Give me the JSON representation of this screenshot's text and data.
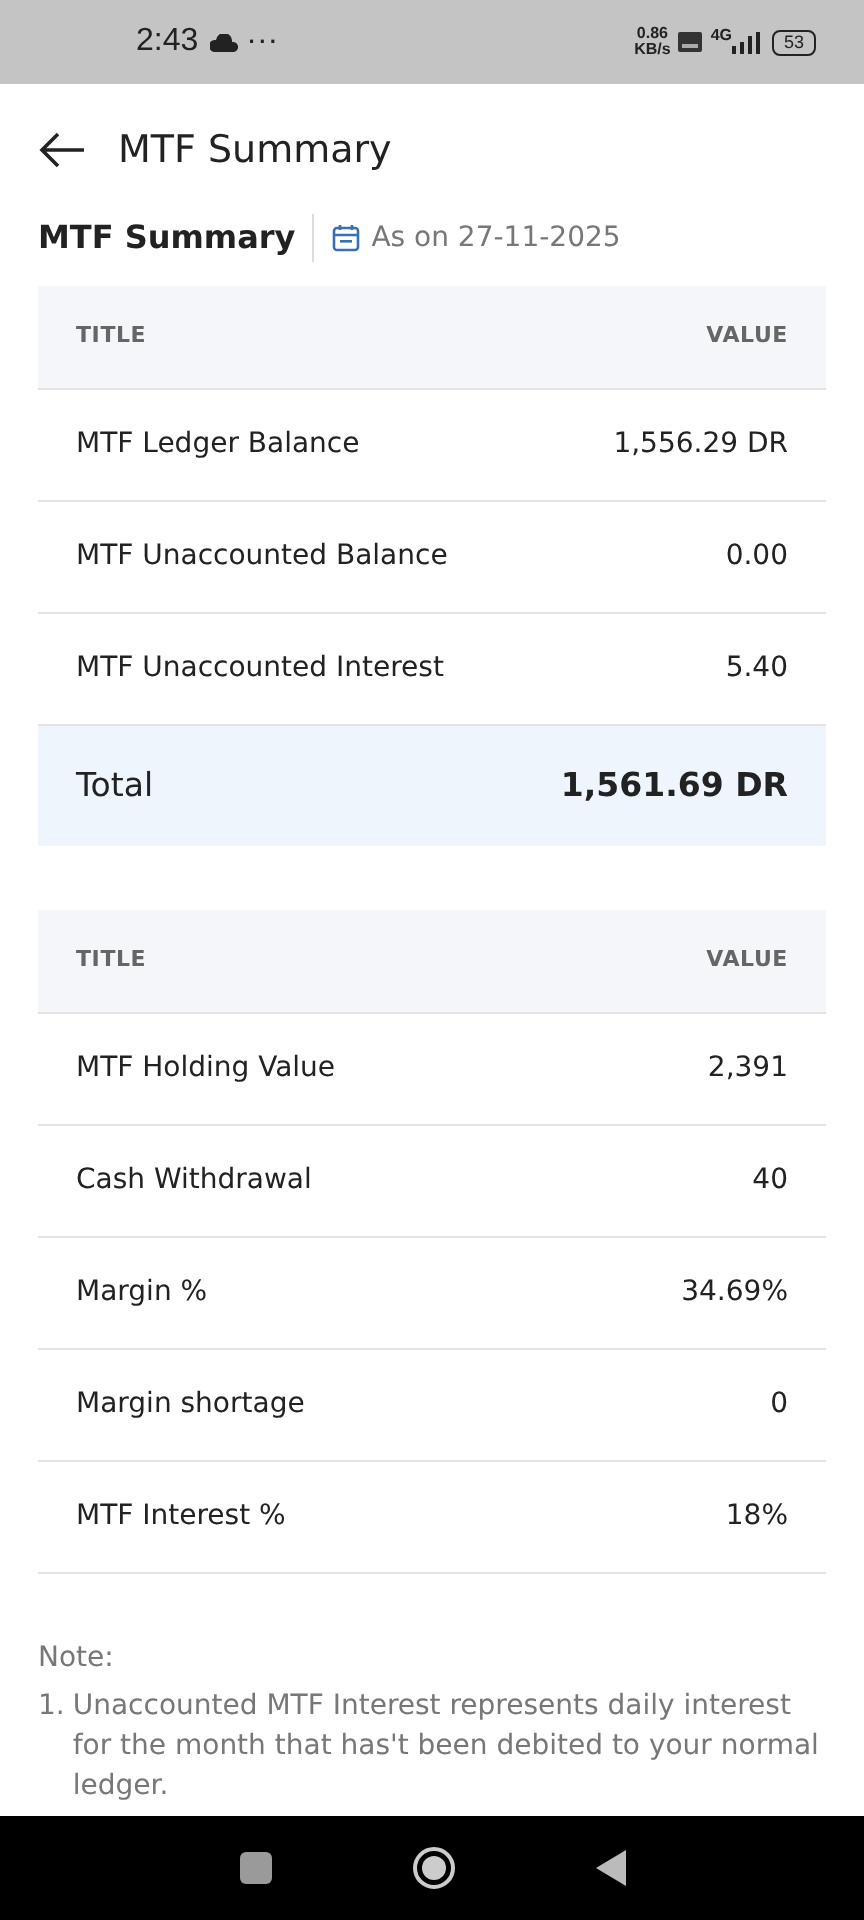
{
  "status_bar": {
    "time": "2:43",
    "dots": "···",
    "speed": [
      "0.86",
      "KB/s"
    ],
    "network": "4G",
    "battery": "53"
  },
  "header": {
    "title": "MTF Summary"
  },
  "subheader": {
    "title": "MTF Summary",
    "date": "As on 27-11-2025"
  },
  "tables": [
    {
      "columns": [
        "TITLE",
        "VALUE"
      ],
      "rows": [
        {
          "kind": "row",
          "title": "MTF Ledger Balance",
          "value": "1,556.29 DR"
        },
        {
          "kind": "row",
          "title": "MTF Unaccounted Balance",
          "value": "0.00"
        },
        {
          "kind": "row",
          "title": "MTF Unaccounted Interest",
          "value": "5.40"
        },
        {
          "kind": "total",
          "title": "Total",
          "value": "1,561.69 DR"
        }
      ]
    },
    {
      "columns": [
        "TITLE",
        "VALUE"
      ],
      "rows": [
        {
          "kind": "row",
          "title": "MTF Holding Value",
          "value": "2,391"
        },
        {
          "kind": "row",
          "title": "Cash Withdrawal",
          "value": "40"
        },
        {
          "kind": "row",
          "title": "Margin %",
          "value": "34.69%"
        },
        {
          "kind": "row",
          "title": "Margin shortage",
          "value": "0"
        },
        {
          "kind": "row",
          "title": "MTF Interest %",
          "value": "18%"
        }
      ]
    }
  ],
  "note": {
    "label": "Note:",
    "items": [
      {
        "number": "1.",
        "text": "Unaccounted MTF Interest represents daily interest for the month that has't been debited to your normal ledger."
      }
    ]
  }
}
